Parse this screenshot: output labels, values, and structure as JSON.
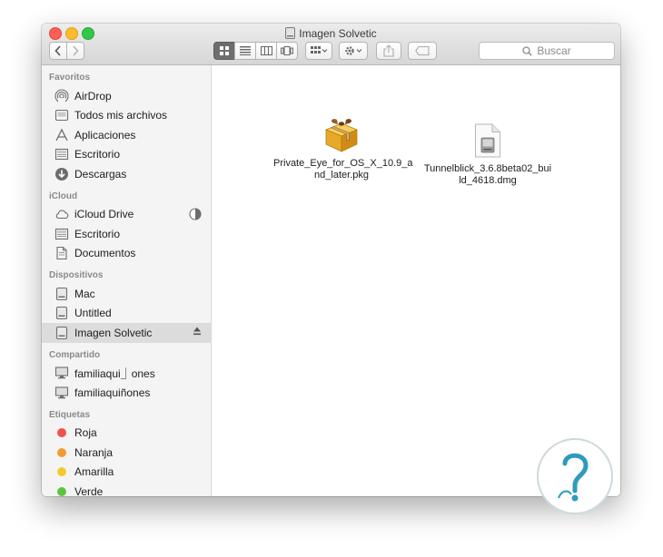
{
  "window": {
    "title": "Imagen Solvetic"
  },
  "toolbar": {
    "back_label": "‹",
    "forward_label": "›",
    "search_placeholder": "Buscar"
  },
  "sidebar": {
    "sections": [
      {
        "header": "Favoritos",
        "items": [
          {
            "label": "AirDrop",
            "icon": "airdrop-icon"
          },
          {
            "label": "Todos mis archivos",
            "icon": "all-files-icon"
          },
          {
            "label": "Aplicaciones",
            "icon": "applications-icon"
          },
          {
            "label": "Escritorio",
            "icon": "desktop-icon"
          },
          {
            "label": "Descargas",
            "icon": "downloads-icon"
          }
        ]
      },
      {
        "header": "iCloud",
        "items": [
          {
            "label": "iCloud Drive",
            "icon": "cloud-icon"
          },
          {
            "label": "Escritorio",
            "icon": "desktop-icon"
          },
          {
            "label": "Documentos",
            "icon": "documents-icon"
          }
        ]
      },
      {
        "header": "Dispositivos",
        "items": [
          {
            "label": "Mac",
            "icon": "drive-icon"
          },
          {
            "label": "Untitled",
            "icon": "drive-icon"
          },
          {
            "label": "Imagen Solvetic",
            "icon": "drive-icon",
            "selected": true
          }
        ]
      },
      {
        "header": "Compartido",
        "items": [
          {
            "label": "familiaqui⏌ones",
            "icon": "computer-icon"
          },
          {
            "label": "familiaquiñones",
            "icon": "computer-icon"
          }
        ]
      },
      {
        "header": "Etiquetas",
        "items": [
          {
            "label": "Roja",
            "color": "#f2504b"
          },
          {
            "label": "Naranja",
            "color": "#f49a34"
          },
          {
            "label": "Amarilla",
            "color": "#f3cb33"
          },
          {
            "label": "Verde",
            "color": "#5dc43f"
          }
        ]
      }
    ]
  },
  "files": [
    {
      "name": "Private_Eye_for_OS_X_10.9_and_later.pkg",
      "line1": "Private_Eye_for_OS_X_10.9_a",
      "line2": "nd_later.pkg",
      "icon": "package-icon"
    },
    {
      "name": "Tunnelblick_3.6.8beta02_build_4618.dmg",
      "line1": "Tunnelblick_3.6.8beta02_bui",
      "line2": "ld_4618.dmg",
      "icon": "disk-image-icon"
    }
  ],
  "colors": {
    "selected_row": "#dcdcdc",
    "sidebar_bg": "#f4f4f4",
    "watermark": "#2e9bbd"
  }
}
